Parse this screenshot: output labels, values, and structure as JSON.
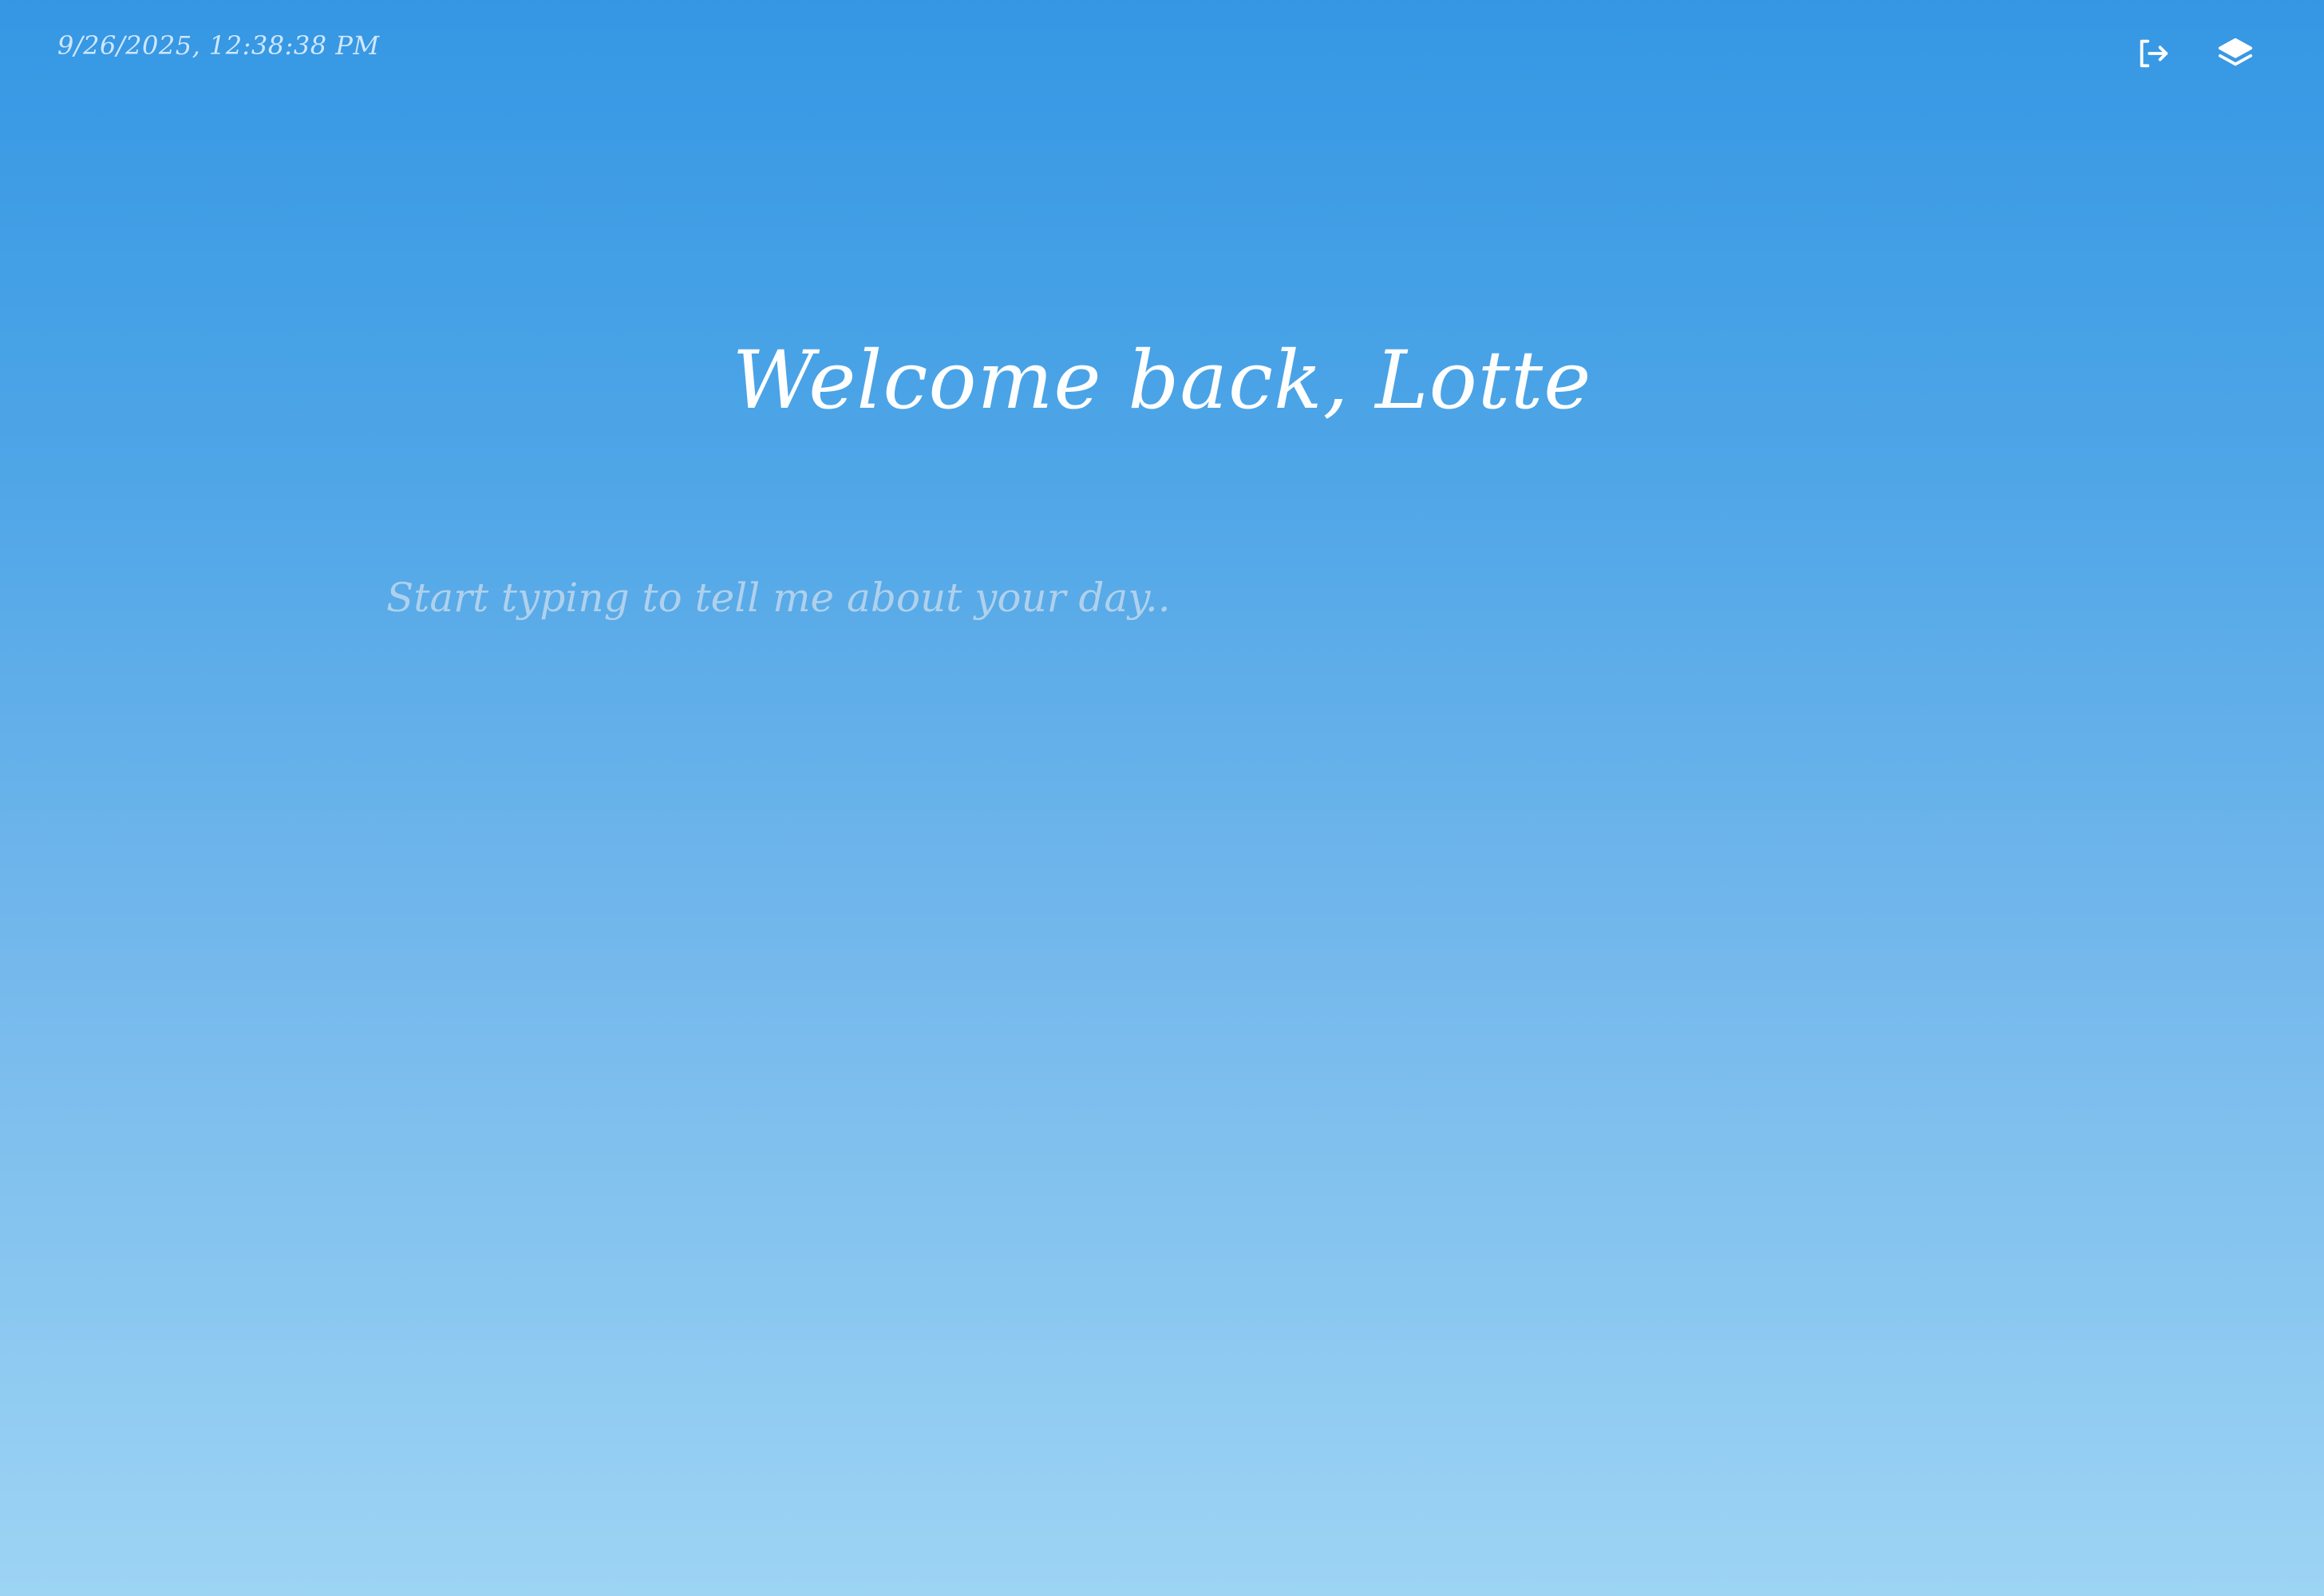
{
  "header": {
    "timestamp": "9/26/2025, 12:38:38 PM",
    "actions": [
      {
        "icon": "logout-icon",
        "label": "Log out"
      },
      {
        "icon": "layers-icon",
        "label": "Entries"
      }
    ]
  },
  "main": {
    "greeting": "Welcome back, Lotte",
    "entry_placeholder": "Start typing to tell me about your day..",
    "entry_value": ""
  },
  "colors": {
    "gradient_top": "#3597e4",
    "gradient_bottom": "#9dd4f4",
    "text": "#ffffff"
  }
}
